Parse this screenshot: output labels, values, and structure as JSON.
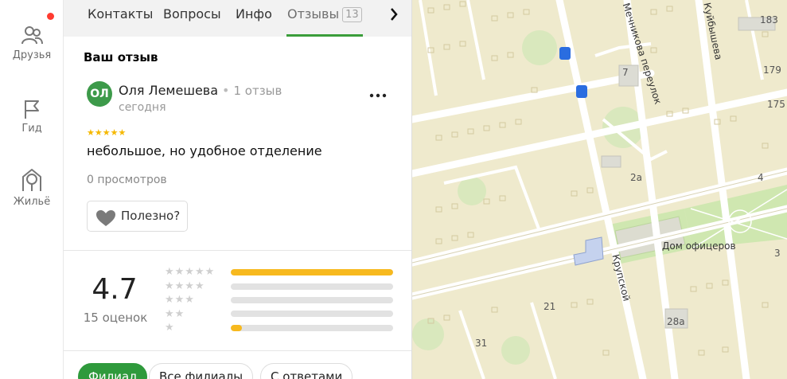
{
  "rail": {
    "items": [
      {
        "label": "Друзья",
        "icon": "friends-icon"
      },
      {
        "label": "Гид",
        "icon": "flag-icon"
      },
      {
        "label": "Жильё",
        "icon": "housing-icon"
      }
    ],
    "notification_color": "#ff3b30"
  },
  "tabs": {
    "items": [
      {
        "label": "Контакты"
      },
      {
        "label": "Вопросы"
      },
      {
        "label": "Инфо"
      },
      {
        "label": "Отзывы",
        "badge": "13"
      }
    ],
    "active_color": "#3a9d3a"
  },
  "review": {
    "section_title": "Ваш отзыв",
    "avatar_initials": "ОЛ",
    "author": "Оля Лемешева",
    "separator": "•",
    "author_reviews": "1 отзыв",
    "date": "сегодня",
    "stars": "★★★★★",
    "rating": 5,
    "text": "небольшое, но удобное отделение",
    "views": "0 просмотров",
    "helpful_label": "Полезно?"
  },
  "summary": {
    "rating": "4.7",
    "count": "15 оценок",
    "distribution": [
      {
        "stars": "★★★★★",
        "fraction": 1.0
      },
      {
        "stars": "★★★★",
        "fraction": 0.0
      },
      {
        "stars": "★★★",
        "fraction": 0.0
      },
      {
        "stars": "★★",
        "fraction": 0.0
      },
      {
        "stars": "★",
        "fraction": 0.07
      }
    ],
    "bar_color": "#f7b91e"
  },
  "filters": [
    {
      "label": "Филиал",
      "active": true
    },
    {
      "label": "Все филиалы",
      "active": false
    },
    {
      "label": "С ответами",
      "active": false
    }
  ],
  "map": {
    "streets": [
      "Мечникова переулок",
      "Куйбышева",
      "Крупской"
    ],
    "place": "Дом офицеров",
    "house_numbers": [
      "183",
      "179",
      "175",
      "7",
      "2a",
      "4",
      "3",
      "21",
      "28a",
      "31"
    ]
  }
}
